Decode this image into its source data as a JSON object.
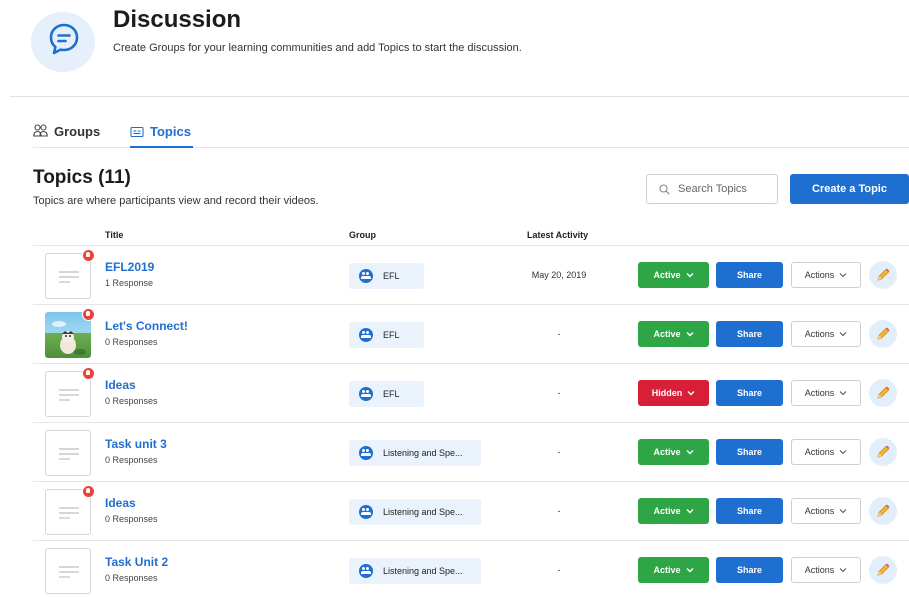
{
  "header": {
    "title": "Discussion",
    "subtitle": "Create Groups for your learning communities and add Topics to start the discussion.",
    "icon": "chat-bubble-icon"
  },
  "tabs": [
    {
      "label": "Groups",
      "icon": "groups-icon",
      "active": false
    },
    {
      "label": "Topics",
      "icon": "topics-icon",
      "active": true
    }
  ],
  "topics_section": {
    "title": "Topics (11)",
    "subtitle": "Topics are where participants view and record their videos.",
    "search_placeholder": "Search Topics",
    "create_label": "Create a Topic"
  },
  "columns": {
    "title": "Title",
    "group": "Group",
    "latest_activity": "Latest Activity"
  },
  "rows": [
    {
      "title": "EFL2019",
      "responses": "1 Response",
      "group": "EFL",
      "latest_activity": "May 20, 2019",
      "status": "Active",
      "share": "Share",
      "actions": "Actions",
      "thumb": "placeholder",
      "badge": true
    },
    {
      "title": "Let's Connect!",
      "responses": "0 Responses",
      "group": "EFL",
      "latest_activity": "-",
      "status": "Active",
      "share": "Share",
      "actions": "Actions",
      "thumb": "image",
      "badge": true
    },
    {
      "title": "Ideas",
      "responses": "0 Responses",
      "group": "EFL",
      "latest_activity": "-",
      "status": "Hidden",
      "share": "Share",
      "actions": "Actions",
      "thumb": "placeholder",
      "badge": true
    },
    {
      "title": "Task unit 3",
      "responses": "0 Responses",
      "group": "Listening and Spe...",
      "latest_activity": "-",
      "status": "Active",
      "share": "Share",
      "actions": "Actions",
      "thumb": "placeholder",
      "badge": false
    },
    {
      "title": "Ideas",
      "responses": "0 Responses",
      "group": "Listening and Spe...",
      "latest_activity": "-",
      "status": "Active",
      "share": "Share",
      "actions": "Actions",
      "thumb": "placeholder",
      "badge": true
    },
    {
      "title": "Task Unit 2",
      "responses": "0 Responses",
      "group": "Listening and Spe...",
      "latest_activity": "-",
      "status": "Active",
      "share": "Share",
      "actions": "Actions",
      "thumb": "placeholder",
      "badge": false
    }
  ],
  "colors": {
    "primary": "#1f6fd0",
    "active": "#2fa646",
    "hidden": "#d71f37",
    "badge": "#e8433a"
  }
}
